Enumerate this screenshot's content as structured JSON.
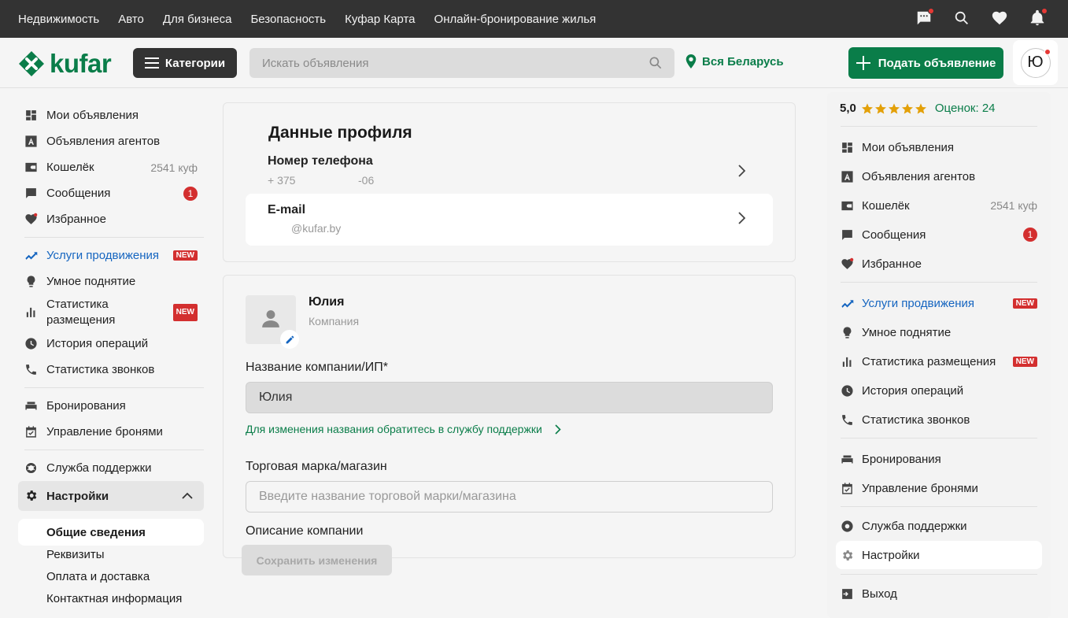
{
  "topnav": [
    "Недвижимость",
    "Авто",
    "Для бизнеса",
    "Безопасность",
    "Куфар Карта",
    "Онлайн-бронирование жилья"
  ],
  "header": {
    "logo": "kufar",
    "categories": "Категории",
    "search_placeholder": "Искать объявления",
    "region": "Вся Беларусь",
    "post": "Подать объявление",
    "avatar_letter": "Ю"
  },
  "left": {
    "items": [
      {
        "label": "Мои объявления"
      },
      {
        "label": "Объявления агентов"
      },
      {
        "label": "Кошелёк",
        "right": "2541 куф"
      },
      {
        "label": "Сообщения",
        "badge": "1"
      },
      {
        "label": "Избранное"
      },
      {
        "label": "Услуги продвижения",
        "new": "NEW"
      },
      {
        "label": "Умное поднятие"
      },
      {
        "label": "Статистика размещения",
        "new": "NEW"
      },
      {
        "label": "История операций"
      },
      {
        "label": "Статистика звонков"
      },
      {
        "label": "Бронирования"
      },
      {
        "label": "Управление бронями"
      },
      {
        "label": "Служба поддержки"
      },
      {
        "label": "Настройки"
      }
    ],
    "sub": [
      "Общие сведения",
      "Реквизиты",
      "Оплата и доставка",
      "Контактная информация"
    ]
  },
  "profile": {
    "title": "Данные профиля",
    "phone_label": "Номер телефона",
    "phone_value_a": "+ 375",
    "phone_value_b": "-06",
    "email_label": "E-mail",
    "email_value": "@kufar.by"
  },
  "company": {
    "name": "Юлия",
    "type": "Компания",
    "name_label": "Название компании/ИП*",
    "name_value": "Юлия",
    "support_link": "Для изменения названия обратитесь в службу поддержки",
    "brand_label": "Торговая марка/магазин",
    "brand_placeholder": "Введите название торговой марки/магазина",
    "desc_label": "Описание компании",
    "save": "Сохранить изменения"
  },
  "right": {
    "rating": "5,0",
    "reviews": "Оценок: 24",
    "items": [
      {
        "label": "Мои объявления"
      },
      {
        "label": "Объявления агентов"
      },
      {
        "label": "Кошелёк",
        "right": "2541 куф"
      },
      {
        "label": "Сообщения",
        "badge": "1"
      },
      {
        "label": "Избранное"
      },
      {
        "label": "Услуги продвижения",
        "new": "NEW"
      },
      {
        "label": "Умное поднятие"
      },
      {
        "label": "Статистика размещения",
        "new": "NEW"
      },
      {
        "label": "История операций"
      },
      {
        "label": "Статистика звонков"
      },
      {
        "label": "Бронирования"
      },
      {
        "label": "Управление бронями"
      },
      {
        "label": "Служба поддержки"
      },
      {
        "label": "Настройки"
      },
      {
        "label": "Выход"
      }
    ]
  },
  "colors": {
    "brand": "#0a7d49",
    "promo": "#1565c0",
    "badge": "#d32f2f",
    "star": "#e3a008"
  }
}
